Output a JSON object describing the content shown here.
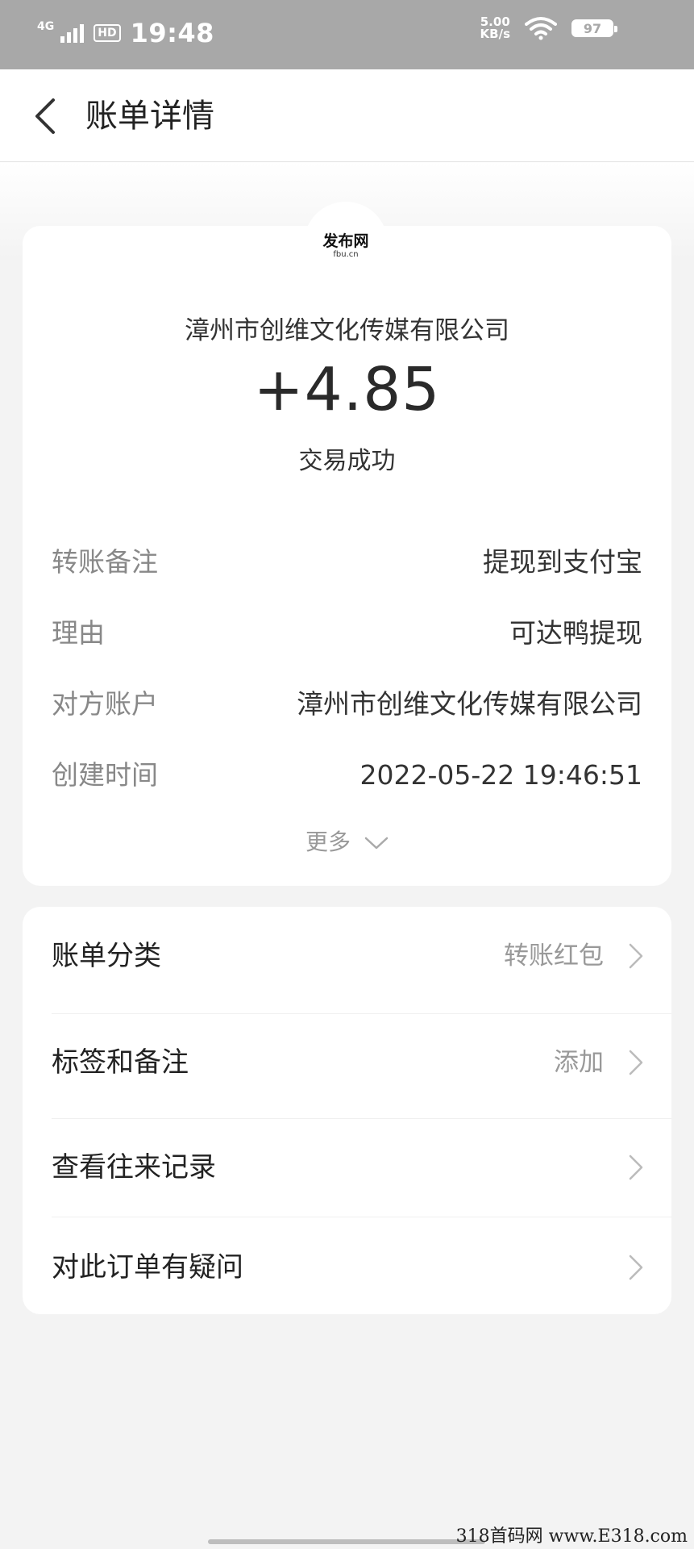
{
  "status_bar": {
    "network": "4G",
    "hd": "HD",
    "time": "19:48",
    "speed_value": "5.00",
    "speed_unit": "KB/s",
    "battery": "97"
  },
  "nav": {
    "title": "账单详情"
  },
  "logo": {
    "main": "发布网",
    "sub": "fbu.cn"
  },
  "summary": {
    "merchant": "漳州市创维文化传媒有限公司",
    "amount": "+4.85",
    "status": "交易成功"
  },
  "details": [
    {
      "label": "转账备注",
      "value": "提现到支付宝"
    },
    {
      "label": "理由",
      "value": "可达鸭提现"
    },
    {
      "label": "对方账户",
      "value": "漳州市创维文化传媒有限公司"
    },
    {
      "label": "创建时间",
      "value": "2022-05-22 19:46:51"
    }
  ],
  "more_label": "更多",
  "actions": [
    {
      "label": "账单分类",
      "value": "转账红包"
    },
    {
      "label": "标签和备注",
      "value": "添加"
    },
    {
      "label": "查看往来记录",
      "value": ""
    },
    {
      "label": "对此订单有疑问",
      "value": ""
    }
  ],
  "watermark": "318首码网 www.E318.com"
}
